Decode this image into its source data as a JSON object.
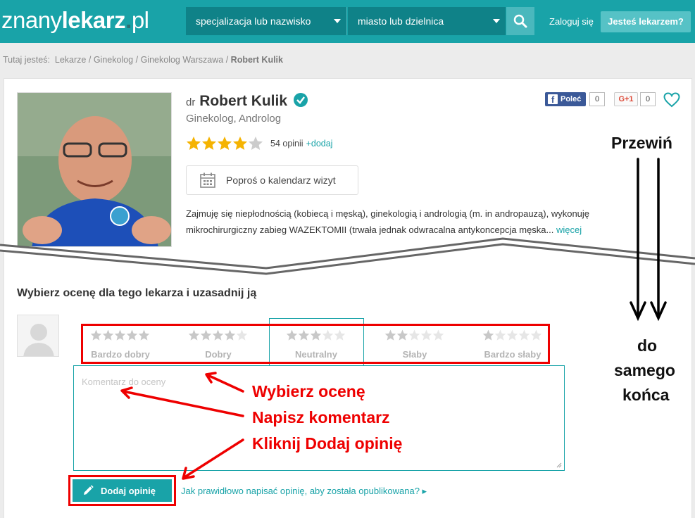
{
  "header": {
    "logo_prefix": "znany",
    "logo_bold": "lekarz",
    "logo_dot": ".",
    "logo_suffix": "pl",
    "specialty_placeholder": "specjalizacja lub nazwisko",
    "city_placeholder": "miasto lub dzielnica",
    "login_label": "Zaloguj się",
    "doctor_button_label": "Jesteś lekarzem?"
  },
  "breadcrumb": {
    "prefix": "Tutaj jesteś:",
    "items": [
      "Lekarze",
      "Ginekolog",
      "Ginekolog Warszawa"
    ],
    "separator": "/",
    "current": "Robert Kulik"
  },
  "doctor": {
    "title_prefix": "dr",
    "name": "Robert Kulik",
    "specialty": "Ginekolog, Androlog",
    "rating": 4.5,
    "reviews_count": "54 opinii",
    "add_review_link": "+dodaj",
    "calendar_button": "Poproś o kalendarz wizyt",
    "description": "Zajmuję się niepłodnością (kobiecą i męską), ginekologią i andrologią (m. in andropauzą), wykonuję mikrochirurgiczny zabieg WAZEKTOMII (trwała jednak odwracalna antykoncepcja męska...",
    "more_link": "więcej"
  },
  "social": {
    "facebook_label": "Poleć",
    "facebook_count": "0",
    "gplus_label": "G+1",
    "gplus_count": "0"
  },
  "rating_form": {
    "title": "Wybierz ocenę dla tego lekarza i uzasadnij ją",
    "options": [
      {
        "label": "Bardzo dobry",
        "stars": 5
      },
      {
        "label": "Dobry",
        "stars": 4
      },
      {
        "label": "Neutralny",
        "stars": 3
      },
      {
        "label": "Słaby",
        "stars": 2
      },
      {
        "label": "Bardzo słaby",
        "stars": 1
      }
    ],
    "selected_option": "Neutralny",
    "comment_placeholder": "Komentarz do oceny",
    "submit_label": "Dodaj opinię",
    "help_link": "Jak prawidłowo napisać opinię, aby została opublikowana? ▸"
  },
  "annotations": {
    "step1": "Wybierz ocenę",
    "step2": "Napisz komentarz",
    "step3": "Kliknij Dodaj opinię",
    "scroll_top": "Przewiń",
    "scroll_bottom_1": "do",
    "scroll_bottom_2": "samego",
    "scroll_bottom_3": "końca"
  },
  "colors": {
    "brand": "#19a3a8",
    "brand_dark": "#0f8288",
    "star": "#f5b301",
    "annotation_red": "#e00000",
    "facebook": "#3b5998"
  }
}
